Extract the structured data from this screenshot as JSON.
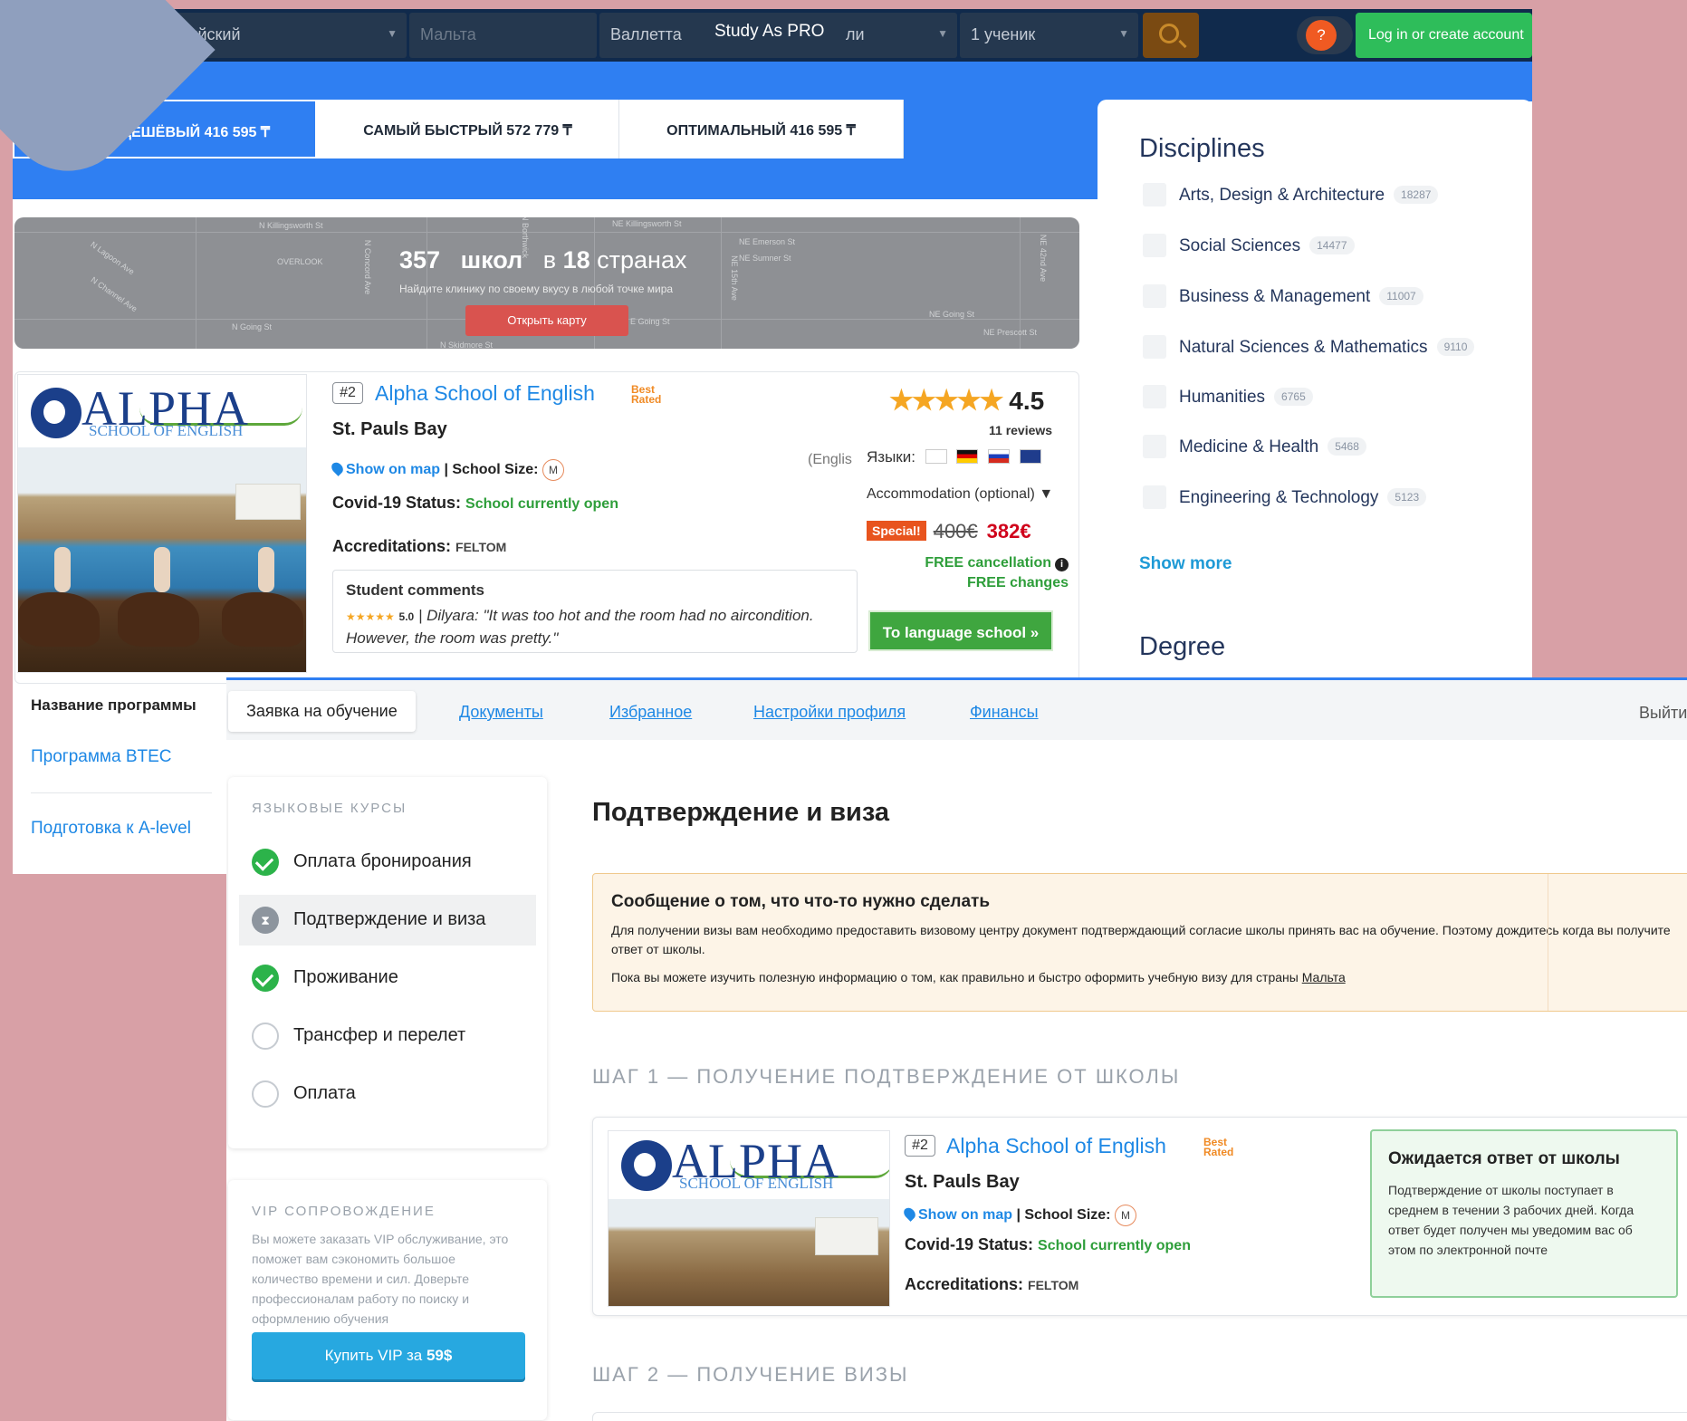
{
  "shot1": {
    "nav": {
      "language": "Анлийский",
      "country": "Мальта",
      "city": "Валлетта",
      "brand": "Study As PRO",
      "brand_trail": "ли",
      "students": "1 ученик",
      "help": "?",
      "login": "Log in or create account"
    },
    "tabs": [
      {
        "label": "САМЫЙ ДЕШЁВЫЙ 416 595 ₸"
      },
      {
        "label": "САМЫЙ БЫСТРЫЙ 572 779 ₸"
      },
      {
        "label": "ОПТИМАЛЬНЫЙ 416 595 ₸"
      }
    ],
    "map": {
      "count": "357",
      "word_schools": "школ",
      "in": "в",
      "countries_count": "18",
      "countries": "странах",
      "subtitle": "Найдите клинику по своему вкусу в любой точке мира",
      "button": "Открыть карту",
      "streets": [
        "N Killingsworth St",
        "OVERLOOK",
        "N Lagoon Ave",
        "N Channel Ave",
        "N Going St",
        "N Skidmore St",
        "N Concord Ave",
        "NE Killingsworth St",
        "NE Emerson St",
        "NE Sumner St",
        "NE Going St",
        "NE Prescott St",
        "NE 42nd Ave",
        "NE 15th Ave",
        "N Borthwick",
        "E Going St"
      ]
    },
    "school": {
      "rank": "#2",
      "name": "Alpha School of English",
      "badge_line1": "Best",
      "badge_line2": "Rated",
      "city": "St. Pauls Bay",
      "show_on_map": "Show on map",
      "size_label": "| School Size:",
      "size": "M",
      "covid_label": "Covid-19 Status:",
      "covid_value": "School currently open",
      "accr_label": "Accreditations:",
      "accr_value": "FELTOM",
      "comments_title": "Student comments",
      "comment_stars": "★★★★★",
      "comment_score": "5.0",
      "comment_text": "| Dilyara: \"It was too hot and the room had no aircondition. However, the room was pretty.\"",
      "logo_word": "ALPHA",
      "logo_sub": "SCHOOL OF ENGLISH",
      "stars": "★★★★★",
      "rating": "4.5",
      "reviews": "11 reviews",
      "engl": "(Englis",
      "languages_label": "Языки:",
      "accommodation": "Accommodation (optional) ▼",
      "special": "Special!",
      "old_price": "400€",
      "new_price": "382€",
      "free_cancel": "FREE cancellation",
      "free_changes": "FREE changes",
      "to_school": "To language school »"
    },
    "disciplines": {
      "title": "Disciplines",
      "items": [
        {
          "label": "Arts, Design & Architecture",
          "count": "18287"
        },
        {
          "label": "Social Sciences",
          "count": "14477"
        },
        {
          "label": "Business & Management",
          "count": "11007"
        },
        {
          "label": "Natural Sciences & Mathematics",
          "count": "9110"
        },
        {
          "label": "Humanities",
          "count": "6765"
        },
        {
          "label": "Medicine & Health",
          "count": "5468"
        },
        {
          "label": "Engineering & Technology",
          "count": "5123"
        }
      ],
      "show_more": "Show more",
      "degree": "Degree"
    },
    "programs": {
      "title": "Название программы",
      "items": [
        "Программа BTEC",
        "Подготовка к A-level"
      ]
    }
  },
  "shot2": {
    "tabs": [
      {
        "label": "Заявка на обучение"
      },
      {
        "label": "Документы"
      },
      {
        "label": "Избранное"
      },
      {
        "label": "Настройки профиля"
      },
      {
        "label": "Финансы"
      }
    ],
    "exit": "Выйти",
    "steps_title": "ЯЗЫКОВЫЕ КУРСЫ",
    "steps": [
      {
        "label": "Оплата бронироания",
        "state": "done"
      },
      {
        "label": "Подтверждение и виза",
        "state": "wait"
      },
      {
        "label": "Проживание",
        "state": "done"
      },
      {
        "label": "Трансфер и перелет",
        "state": "empty"
      },
      {
        "label": "Оплата",
        "state": "empty"
      }
    ],
    "vip": {
      "title": "VIP СОПРОВОЖДЕНИЕ",
      "text": "Вы можете заказать VIP обслуживание, это поможет вам сэкономить большое количество времени и сил. Доверьте профессионалам работу по поиску и оформлению обучения",
      "button_prefix": "Купить VIP за ",
      "button_price": "59$"
    },
    "page_title": "Подтверждение и виза",
    "notice": {
      "title": "Сообщение о том, что что-то нужно сделать",
      "p1": "Для получении визы вам необходимо предоставить визовому центру документ подтверждающий согласие школы принять вас на обучение. Поэтому дождитесь когда вы получите ответ от школы.",
      "p2": "Пока вы можете изучить полезную информацию о том, как правильно и быстро оформить учебную визу для страны",
      "p2_link": "Мальта"
    },
    "step1": "ШАГ 1 — ПОЛУЧЕНИЕ ПОДТВЕРЖДЕНИЕ ОТ ШКОЛЫ",
    "step2": "ШАГ 2 — ПОЛУЧЕНИЕ ВИЗЫ",
    "wait": {
      "title": "Ожидается ответ от школы",
      "text": "Подтверждение от школы поступает в среднем в течении 3 рабочих дней. Когда ответ будет получен мы уведомим вас об этом по электронной почте"
    }
  }
}
